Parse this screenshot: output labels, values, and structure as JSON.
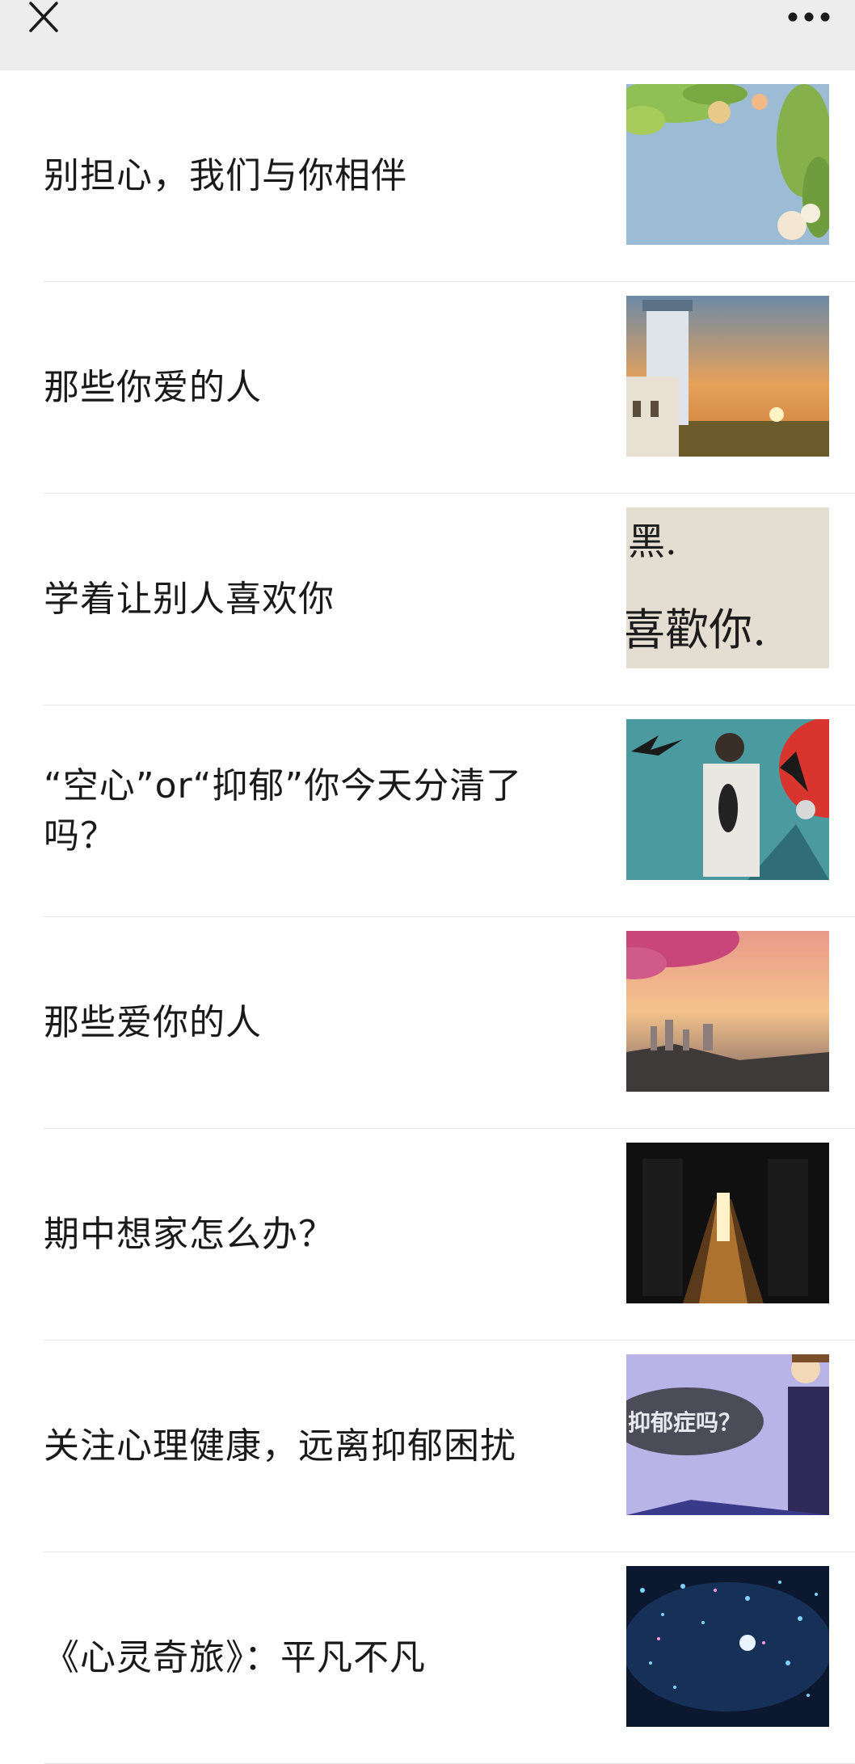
{
  "topbar": {
    "close_icon": "close-icon",
    "more_icon": "more-icon"
  },
  "articles": [
    {
      "title": "别担心，我们与你相伴",
      "thumb": "flowers-sky-thumbnail"
    },
    {
      "title": "那些你爱的人",
      "thumb": "lighthouse-sunset-thumbnail"
    },
    {
      "title": "学着让别人喜欢你",
      "thumb": "handwriting-wall-thumbnail"
    },
    {
      "title": "“空心”or“抑郁”你今天分清了吗？",
      "thumb": "man-hollow-chest-thumbnail"
    },
    {
      "title": "那些爱你的人",
      "thumb": "cherry-blossom-city-thumbnail"
    },
    {
      "title": "期中想家怎么办？",
      "thumb": "dark-corridor-thumbnail"
    },
    {
      "title": "关注心理健康，远离抑郁困扰",
      "thumb": "depression-cartoon-thumbnail"
    },
    {
      "title": "《心灵奇旅》：平凡不凡",
      "thumb": "soul-movie-lights-thumbnail"
    }
  ],
  "thumbnail_texts": {
    "handwriting_top": "黑.",
    "handwriting_bottom": "喜歡你.",
    "cartoon_bubble": "抑郁症吗？"
  }
}
